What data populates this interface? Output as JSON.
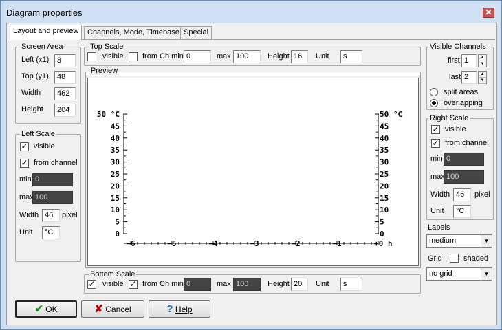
{
  "window": {
    "title": "Diagram properties",
    "close_glyph": "✕"
  },
  "tabs": [
    "Layout and preview",
    "Channels, Mode, Timebase",
    "Special"
  ],
  "screen_area": {
    "title": "Screen Area",
    "left_label": "Left (x1)",
    "left_value": "8",
    "top_label": "Top (y1)",
    "top_value": "48",
    "width_label": "Width",
    "width_value": "462",
    "height_label": "Height",
    "height_value": "204"
  },
  "top_scale": {
    "title": "Top Scale",
    "visible_label": "visible",
    "visible_checked": false,
    "from_ch_label": "from Ch min",
    "from_ch_checked": false,
    "min_value": "0",
    "max_label": "max",
    "max_value": "100",
    "height_label": "Height",
    "height_value": "16",
    "unit_label": "Unit",
    "unit_value": "s"
  },
  "left_scale": {
    "title": "Left Scale",
    "visible_label": "visible",
    "visible_checked": true,
    "from_channel_label": "from channel",
    "from_channel_checked": true,
    "min_label": "min",
    "min_value": "0",
    "max_label": "max",
    "max_value": "100",
    "width_label": "Width",
    "width_value": "46",
    "width_unit": "pixel",
    "unit_label": "Unit",
    "unit_value": "°C"
  },
  "preview": {
    "title": "Preview",
    "left_ticks": [
      "50 °C",
      "45",
      "40",
      "35",
      "30",
      "25",
      "20",
      "15",
      "10",
      "5",
      "0"
    ],
    "right_ticks": [
      "50 °C",
      "45",
      "40",
      "35",
      "30",
      "25",
      "20",
      "15",
      "10",
      "5",
      "0"
    ],
    "bottom_ticks": [
      "−6",
      "−5",
      "−4",
      "−3",
      "−2",
      "−1",
      "+0 h"
    ]
  },
  "bottom_scale": {
    "title": "Bottom Scale",
    "visible_label": "visible",
    "visible_checked": true,
    "from_ch_label": "from Ch min",
    "from_ch_checked": true,
    "min_value": "0",
    "max_label": "max",
    "max_value": "100",
    "height_label": "Height",
    "height_value": "20",
    "unit_label": "Unit",
    "unit_value": "s"
  },
  "visible_channels": {
    "title": "Visible Channels",
    "first_label": "first",
    "first_value": "1",
    "last_label": "last",
    "last_value": "2",
    "split_label": "split areas",
    "overlap_label": "overlapping",
    "selected_mode": "overlapping"
  },
  "right_scale": {
    "title": "Right Scale",
    "visible_label": "visible",
    "visible_checked": true,
    "from_channel_label": "from channel",
    "from_channel_checked": true,
    "min_label": "min",
    "min_value": "0",
    "max_label": "max",
    "max_value": "100",
    "width_label": "Width",
    "width_value": "46",
    "width_unit": "pixel",
    "unit_label": "Unit",
    "unit_value": "°C"
  },
  "labels": {
    "title": "Labels",
    "value": "medium"
  },
  "grid": {
    "title": "Grid",
    "shaded_label": "shaded",
    "shaded_checked": false,
    "value": "no grid"
  },
  "buttons": {
    "ok": "OK",
    "cancel": "Cancel",
    "help": "Help"
  },
  "icons": {
    "ok": "check-icon",
    "cancel": "x-icon",
    "help": "question-icon",
    "dropdown": "chevron-down-icon"
  },
  "colors": {
    "window_frame": "#cfe0f5",
    "dialog_bg": "#f0f0f0",
    "ok_icon": "#1b8a1b",
    "cancel_icon": "#c00000",
    "help_icon": "#2060c0"
  }
}
